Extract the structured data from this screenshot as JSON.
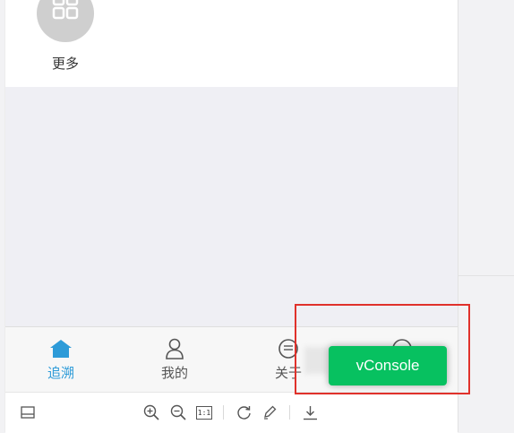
{
  "menu": {
    "more_label": "更多",
    "more_icon": "grid-icon"
  },
  "tabbar": {
    "tabs": [
      {
        "label": "追溯",
        "icon": "home-icon",
        "active": true
      },
      {
        "label": "我的",
        "icon": "person-icon",
        "active": false
      },
      {
        "label": "关于",
        "icon": "info-icon",
        "active": false
      },
      {
        "label": "",
        "icon": "settings-icon",
        "active": false
      }
    ],
    "active_color": "#2d9bd8"
  },
  "toolbar": {
    "icons": [
      "panel-icon",
      "zoom-in-icon",
      "zoom-out-icon",
      "actual-size-icon",
      "rotate-icon",
      "edit-icon",
      "download-icon"
    ],
    "actual_size_label": "1:1"
  },
  "vconsole": {
    "label": "vConsole",
    "color": "#07c160"
  },
  "highlight_color": "#e0312b"
}
